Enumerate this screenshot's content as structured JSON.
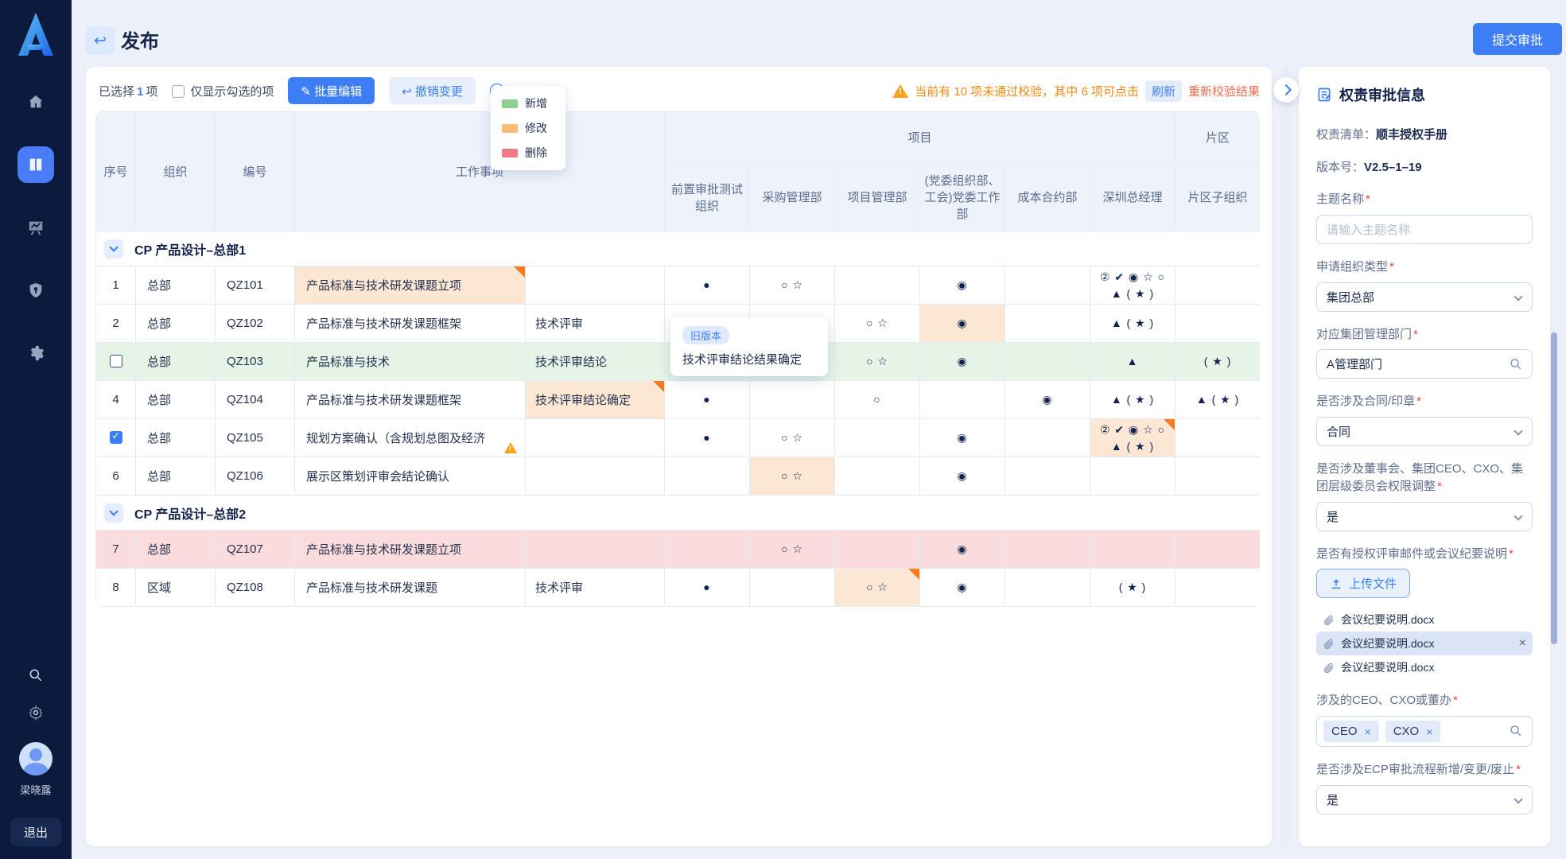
{
  "colors": {
    "primary": "#3d7ef7",
    "warning_orange": "#f28914",
    "result_link_red": "#f26a4b",
    "added_green": "#8ed08e",
    "modified_orange": "#f7bd77",
    "deleted_red": "#ee7a87",
    "row_green": "#e6f4e7",
    "row_pink": "#fbdcdc",
    "cell_highlight_orange": "#fbe7d4",
    "corner_orange": "#f97a1d"
  },
  "sidebar": {
    "icons": [
      "home-icon",
      "book-icon",
      "dashboard-icon",
      "shield-icon",
      "gear-icon",
      "search-icon",
      "settings-icon"
    ],
    "user_name": "梁晓露",
    "logout_label": "退出"
  },
  "header": {
    "title": "发布",
    "submit_label": "提交审批"
  },
  "toolbar": {
    "selected_pre": "已选择",
    "selected_count": "1",
    "selected_post": "项",
    "only_checked_label": "仅显示勾选的项",
    "batch_edit_label": "批量编辑",
    "undo_label": "撤销变更"
  },
  "legend": {
    "items": [
      {
        "label": "新增",
        "color": "#8ed08e"
      },
      {
        "label": "修改",
        "color": "#f7bd77"
      },
      {
        "label": "删除",
        "color": "#ee7a87"
      }
    ]
  },
  "warnbar": {
    "text": "当前有 10 项未通过校验，其中 6 项可点击",
    "refresh_label": "刷新",
    "text2": "重新校验结果"
  },
  "tooltip": {
    "badge": "旧版本",
    "text": "技术评审结论结果确定"
  },
  "table": {
    "columns": {
      "seq": "序号",
      "org": "组织",
      "code": "编号",
      "item": "工作事项",
      "project_group": "项目",
      "project_cols": [
        "前置审批测试组织",
        "采购管理部",
        "项目管理部",
        "(党委组织部、工会)党委工作部",
        "成本合约部",
        "深圳总经理"
      ],
      "zone_group": "片区",
      "zone_col": "片区子组织"
    },
    "groups": [
      {
        "title": "CP 产品设计–总部1",
        "rows": [
          {
            "seq": "1",
            "org": "总部",
            "code": "QZ101",
            "item": "产品标准与技术研发课题立项",
            "item_hl": true,
            "item_corner": true,
            "step": "",
            "cells": [
              {
                "t": "●"
              },
              {
                "t": "○ ☆"
              },
              {
                "t": ""
              },
              {
                "t": "◉"
              },
              {
                "t": ""
              },
              {
                "t": "② ✔ ◉ ☆ ○\n▲ ( ★ )"
              },
              {
                "t": ""
              }
            ]
          },
          {
            "seq": "2",
            "org": "总部",
            "code": "QZ102",
            "item": "产品标准与技术研发课题框架",
            "step": "技术评审",
            "cells": [
              {
                "t": "●"
              },
              {
                "t": ""
              },
              {
                "t": "○ ☆"
              },
              {
                "t": "◉",
                "hl": true
              },
              {
                "t": ""
              },
              {
                "t": "▲ ( ★ )"
              },
              {
                "t": ""
              }
            ]
          },
          {
            "check": "unchecked",
            "org": "总部",
            "code": "QZ103",
            "item": "产品标准与技术",
            "step": "技术评审结论",
            "row": "row-green",
            "cells": [
              {
                "t": ""
              },
              {
                "t": ""
              },
              {
                "t": "○ ☆"
              },
              {
                "t": "◉"
              },
              {
                "t": ""
              },
              {
                "t": "▲"
              },
              {
                "t": "( ★ )"
              }
            ]
          },
          {
            "seq": "4",
            "org": "总部",
            "code": "QZ104",
            "item": "产品标准与技术研发课题框架",
            "step": "技术评审结论确定",
            "step_hl": true,
            "step_corner": true,
            "cells": [
              {
                "t": "●"
              },
              {
                "t": ""
              },
              {
                "t": "○"
              },
              {
                "t": ""
              },
              {
                "t": "◉"
              },
              {
                "t": "▲ ( ★ )"
              },
              {
                "t": "▲ ( ★ )"
              }
            ]
          },
          {
            "check": "checked",
            "org": "总部",
            "code": "QZ105",
            "item": "规划方案确认（含规划总图及经济",
            "item_warn": true,
            "step": "",
            "cells": [
              {
                "t": "●"
              },
              {
                "t": "○ ☆"
              },
              {
                "t": ""
              },
              {
                "t": "◉"
              },
              {
                "t": ""
              },
              {
                "t": "② ✔ ◉ ☆ ○\n▲ ( ★ )",
                "hl": true,
                "corner": true
              },
              {
                "t": ""
              }
            ]
          },
          {
            "seq": "6",
            "org": "总部",
            "code": "QZ106",
            "item": "展示区策划评审会结论确认",
            "step": "",
            "cells": [
              {
                "t": ""
              },
              {
                "t": "○ ☆",
                "hl": true
              },
              {
                "t": ""
              },
              {
                "t": "◉"
              },
              {
                "t": ""
              },
              {
                "t": ""
              },
              {
                "t": ""
              }
            ]
          }
        ]
      },
      {
        "title": "CP 产品设计–总部2",
        "rows": [
          {
            "seq": "7",
            "org": "总部",
            "code": "QZ107",
            "item": "产品标准与技术研发课题立项",
            "step": "",
            "row": "row-pink",
            "cells": [
              {
                "t": ""
              },
              {
                "t": "○ ☆"
              },
              {
                "t": ""
              },
              {
                "t": "◉"
              },
              {
                "t": ""
              },
              {
                "t": ""
              },
              {
                "t": ""
              }
            ]
          },
          {
            "seq": "8",
            "org": "区域",
            "code": "QZ108",
            "item": "产品标准与技术研发课题",
            "step": "技术评审",
            "cells": [
              {
                "t": "●"
              },
              {
                "t": ""
              },
              {
                "t": "○ ☆",
                "hl": true,
                "corner": true
              },
              {
                "t": "◉"
              },
              {
                "t": ""
              },
              {
                "t": "( ★ )"
              },
              {
                "t": ""
              }
            ]
          }
        ]
      }
    ]
  },
  "panel": {
    "title": "权责审批信息",
    "list_label": "权责清单：",
    "list_value": "顺丰授权手册",
    "version_label": "版本号：",
    "version_value": "V2.5–1–19",
    "topic_label": "主题名称",
    "topic_placeholder": "请输入主题名称",
    "org_type_label": "申请组织类型",
    "org_type_value": "集团总部",
    "mgmt_dept_label": "对应集团管理部门",
    "mgmt_dept_value": "A管理部门",
    "contract_label": "是否涉及合同/印章",
    "contract_value": "合同",
    "board_label": "是否涉及董事会、集团CEO、CXO、集团层级委员会权限调整",
    "board_value": "是",
    "mail_label": "是否有授权评审邮件或会议纪要说明",
    "upload_button": "上传文件",
    "files": [
      {
        "name": "会议纪要说明.docx",
        "selected": false
      },
      {
        "name": "会议纪要说明.docx",
        "selected": true
      },
      {
        "name": "会议纪要说明.docx",
        "selected": false
      }
    ],
    "ceo_label": "涉及的CEO、CXO或董办",
    "ceo_tags": [
      "CEO",
      "CXO"
    ],
    "ecp_label": "是否涉及ECP审批流程新增/变更/废止",
    "ecp_value": "是"
  }
}
